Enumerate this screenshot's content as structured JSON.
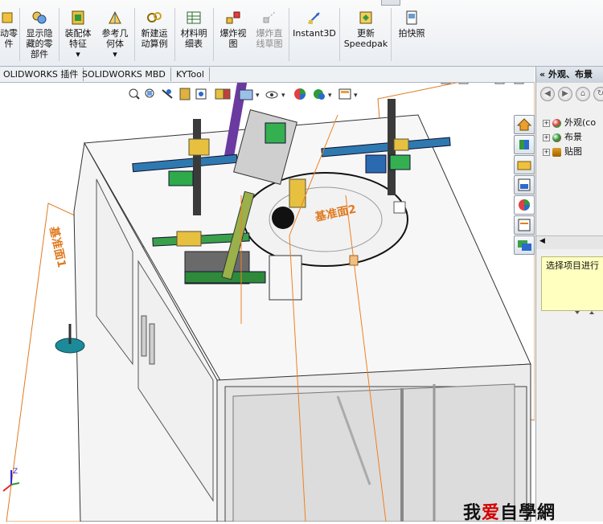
{
  "ribbon": {
    "buttons": [
      {
        "line1": "动零",
        "line2": "件",
        "line3": ""
      },
      {
        "line1": "显示隐",
        "line2": "藏的零",
        "line3": "部件"
      },
      {
        "line1": "装配体",
        "line2": "特征",
        "line3": ""
      },
      {
        "line1": "参考几",
        "line2": "何体",
        "line3": ""
      },
      {
        "line1": "新建运",
        "line2": "动算例",
        "line3": ""
      },
      {
        "line1": "材料明",
        "line2": "细表",
        "line3": ""
      },
      {
        "line1": "爆炸视",
        "line2": "图",
        "line3": ""
      },
      {
        "line1": "爆炸直",
        "line2": "线草图",
        "line3": ""
      },
      {
        "line1": "Instant3D",
        "line2": "",
        "line3": ""
      },
      {
        "line1": "更新",
        "line2": "Speedpak",
        "line3": ""
      },
      {
        "line1": "拍快照",
        "line2": "",
        "line3": ""
      }
    ]
  },
  "tabs": [
    "OLIDWORKS 插件",
    "SOLIDWORKS MBD",
    "KYTool"
  ],
  "viewport": {
    "plane1_label": "基准面1",
    "plane2_label": "基准面2",
    "axis_label": "Z"
  },
  "panel": {
    "title": "外观、布景",
    "tree": [
      {
        "label": "外观(co",
        "color": "#2a8f3a"
      },
      {
        "label": "布景",
        "color": "#d02a2a"
      },
      {
        "label": "贴图",
        "color": "#e0a020"
      }
    ],
    "hint": "选择项目进行"
  },
  "watermark": {
    "part1": "我",
    "part2": "爱",
    "part3": "自學網"
  }
}
